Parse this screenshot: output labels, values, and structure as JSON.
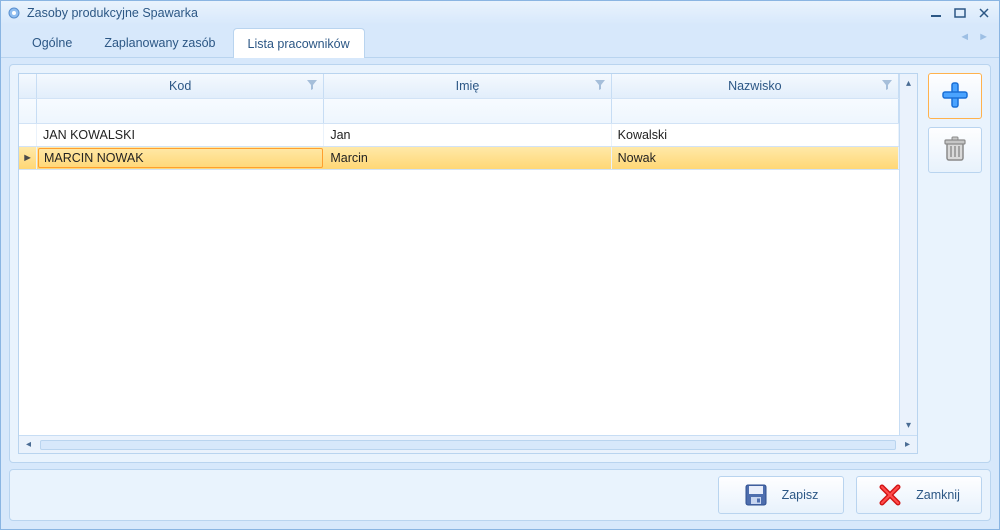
{
  "window": {
    "title": "Zasoby produkcyjne Spawarka"
  },
  "tabs": [
    {
      "label": "Ogólne",
      "active": false
    },
    {
      "label": "Zaplanowany zasób",
      "active": false
    },
    {
      "label": "Lista pracowników",
      "active": true
    }
  ],
  "grid": {
    "columns": [
      {
        "label": "Kod"
      },
      {
        "label": "Imię"
      },
      {
        "label": "Nazwisko"
      }
    ],
    "rows": [
      {
        "code": "JAN KOWALSKI",
        "first": "Jan",
        "last": "Kowalski",
        "selected": false
      },
      {
        "code": "MARCIN NOWAK",
        "first": "Marcin",
        "last": "Nowak",
        "selected": true
      }
    ]
  },
  "buttons": {
    "save": "Zapisz",
    "close": "Zamknij"
  },
  "icons": {
    "app": "gear",
    "minimize": "minimize",
    "maximize": "maximize",
    "closewin": "close",
    "funnel": "filter",
    "add": "plus",
    "delete": "trash",
    "saveIcon": "floppy",
    "closeIcon": "x-red"
  }
}
